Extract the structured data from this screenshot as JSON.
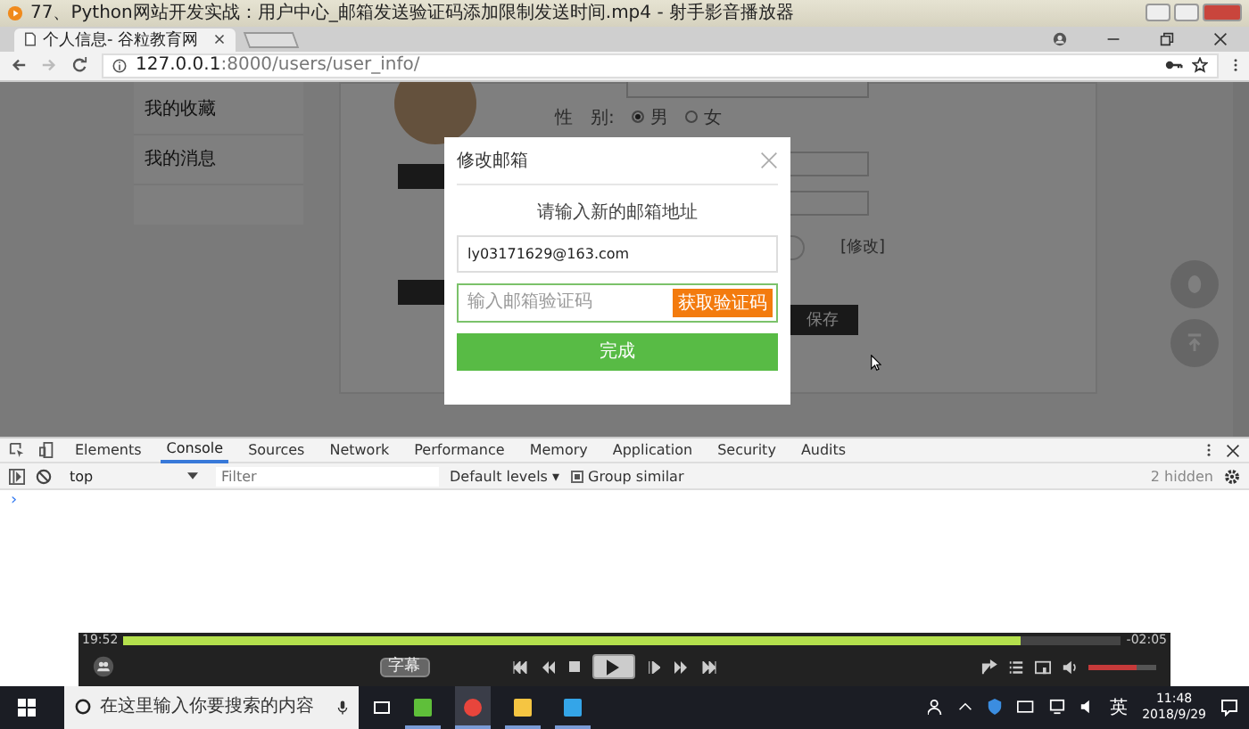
{
  "player_window": {
    "title": "77、Python网站开发实战：用户中心_邮箱发送验证码添加限制发送时间.mp4 - 射手影音播放器"
  },
  "browser": {
    "tabs": [
      {
        "title": "个人信息- 谷粒教育网",
        "selected": true
      }
    ],
    "address": {
      "host": "127.0.0.1",
      "rest": ":8000/users/user_info/"
    }
  },
  "page": {
    "sidebar": [
      {
        "label": "我的收藏"
      },
      {
        "label": "我的消息"
      }
    ],
    "gender_label": "性　别:",
    "gender_options": [
      {
        "label": "男",
        "selected": true
      },
      {
        "label": "女",
        "selected": false
      }
    ],
    "edit_link": "[修改]",
    "save_button": "保存"
  },
  "modal": {
    "title": "修改邮箱",
    "prompt": "请输入新的邮箱地址",
    "email_value": "ly03171629@163.com",
    "code_placeholder": "输入邮箱验证码",
    "code_button": "获取验证码",
    "submit_button": "完成"
  },
  "devtools": {
    "tabs": [
      {
        "label": "Elements",
        "selected": false
      },
      {
        "label": "Console",
        "selected": true
      },
      {
        "label": "Sources",
        "selected": false
      },
      {
        "label": "Network",
        "selected": false
      },
      {
        "label": "Performance",
        "selected": false
      },
      {
        "label": "Memory",
        "selected": false
      },
      {
        "label": "Application",
        "selected": false
      },
      {
        "label": "Security",
        "selected": false
      },
      {
        "label": "Audits",
        "selected": false
      }
    ],
    "context": "top",
    "filter_placeholder": "Filter",
    "levels": "Default levels ▾",
    "group_similar": {
      "label": "Group similar",
      "checked": true
    },
    "hidden_count": "2 hidden",
    "prompt": "›"
  },
  "player": {
    "elapsed": "19:52",
    "remaining": "-02:05",
    "level": 0.9,
    "subtitle_button": "字幕",
    "volume": {
      "level": 0.72
    }
  },
  "taskbar": {
    "search_placeholder": "在这里输入你要搜索的内容",
    "ime": "英",
    "time": "11:48",
    "date": "2018/9/29"
  }
}
